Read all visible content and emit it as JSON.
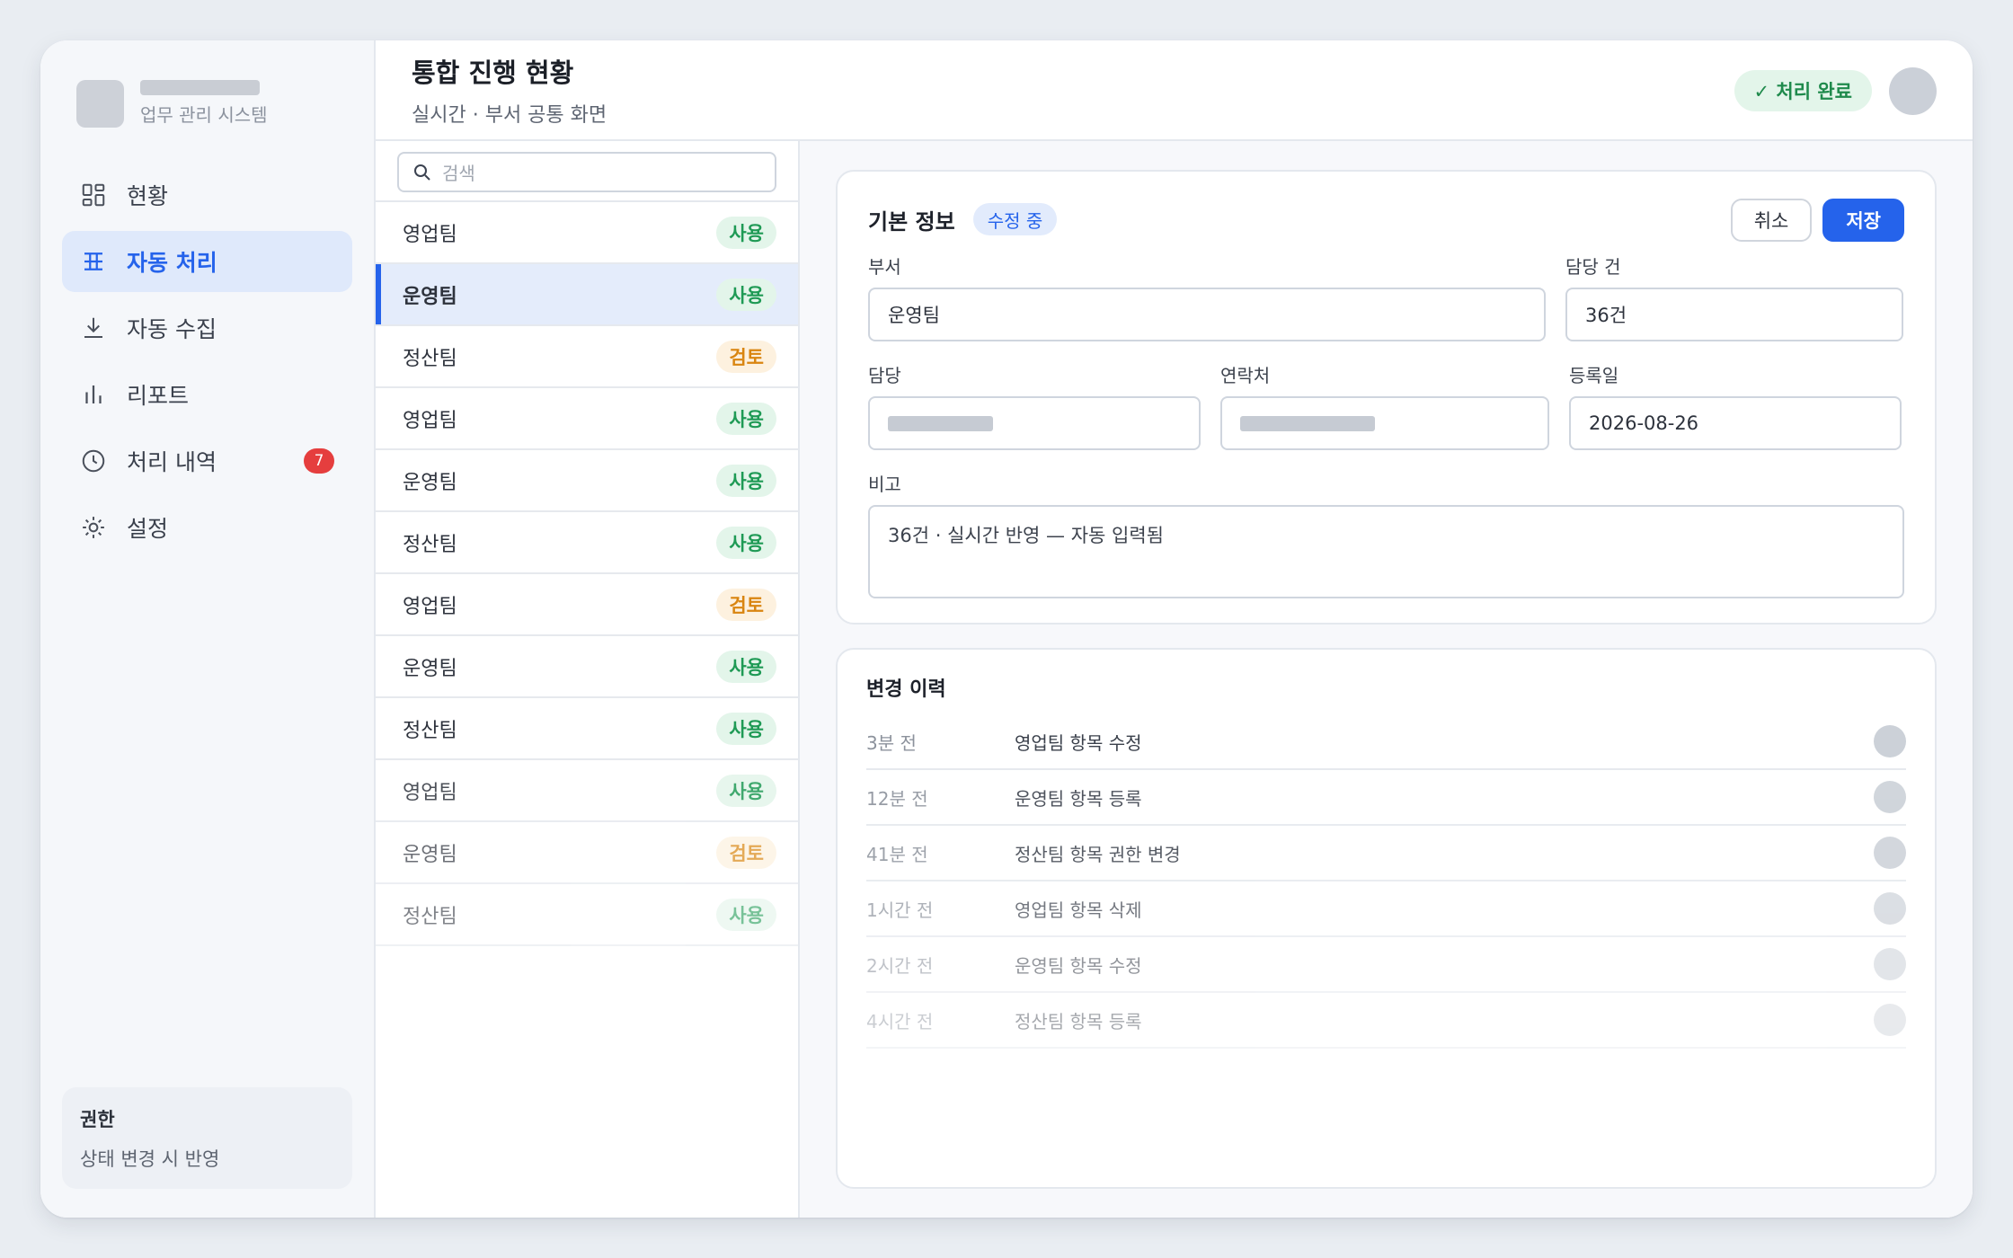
{
  "brand": {
    "subtitle": "업무 관리 시스템"
  },
  "sidebar": {
    "items": [
      {
        "label": "현황",
        "icon": "dashboard-icon",
        "active": false
      },
      {
        "label": "자동 처리",
        "icon": "table-icon",
        "active": true
      },
      {
        "label": "자동 수집",
        "icon": "download-icon",
        "active": false
      },
      {
        "label": "리포트",
        "icon": "bar-chart-icon",
        "active": false
      },
      {
        "label": "처리 내역",
        "icon": "clock-icon",
        "active": false,
        "badge": "7"
      },
      {
        "label": "설정",
        "icon": "gear-icon",
        "active": false
      }
    ],
    "permission": {
      "title": "권한",
      "description": "상태 변경 시 반영"
    }
  },
  "header": {
    "title": "통합 진행 현황",
    "subtitle": "실시간 · 부서 공통 화면",
    "status": "✓ 처리 완료"
  },
  "search": {
    "placeholder": "검색"
  },
  "list": [
    {
      "name": "영업팀",
      "tag": "사용",
      "type": "use"
    },
    {
      "name": "운영팀",
      "tag": "사용",
      "type": "use",
      "selected": true
    },
    {
      "name": "정산팀",
      "tag": "검토",
      "type": "review"
    },
    {
      "name": "영업팀",
      "tag": "사용",
      "type": "use"
    },
    {
      "name": "운영팀",
      "tag": "사용",
      "type": "use"
    },
    {
      "name": "정산팀",
      "tag": "사용",
      "type": "use"
    },
    {
      "name": "영업팀",
      "tag": "검토",
      "type": "review"
    },
    {
      "name": "운영팀",
      "tag": "사용",
      "type": "use"
    },
    {
      "name": "정산팀",
      "tag": "사용",
      "type": "use"
    },
    {
      "name": "영업팀",
      "tag": "사용",
      "type": "use"
    },
    {
      "name": "운영팀",
      "tag": "검토",
      "type": "review"
    },
    {
      "name": "정산팀",
      "tag": "사용",
      "type": "use"
    }
  ],
  "detail": {
    "title": "기본 정보",
    "edit_status": "수정 중",
    "cancel_label": "취소",
    "save_label": "저장",
    "fields": {
      "department_label": "부서",
      "department_value": "운영팀",
      "count_label": "담당 건",
      "count_value": "36건",
      "owner_label": "담당",
      "contact_label": "연락처",
      "date_label": "등록일",
      "date_value": "2026-08-26",
      "note_label": "비고",
      "note_value": "36건 · 실시간 반영 — 자동 입력됨"
    }
  },
  "history": {
    "title": "변경 이력",
    "rows": [
      {
        "time": "3분 전",
        "text": "영업팀 항목 수정"
      },
      {
        "time": "12분 전",
        "text": "운영팀 항목 등록"
      },
      {
        "time": "41분 전",
        "text": "정산팀 항목 권한 변경"
      },
      {
        "time": "1시간 전",
        "text": "영업팀 항목 삭제"
      },
      {
        "time": "2시간 전",
        "text": "운영팀 항목 수정"
      },
      {
        "time": "4시간 전",
        "text": "정산팀 항목 등록"
      }
    ]
  },
  "colors": {
    "accent": "#2563eb",
    "success": "#1f9a55",
    "warning": "#d98510",
    "danger": "#e53e3e"
  }
}
